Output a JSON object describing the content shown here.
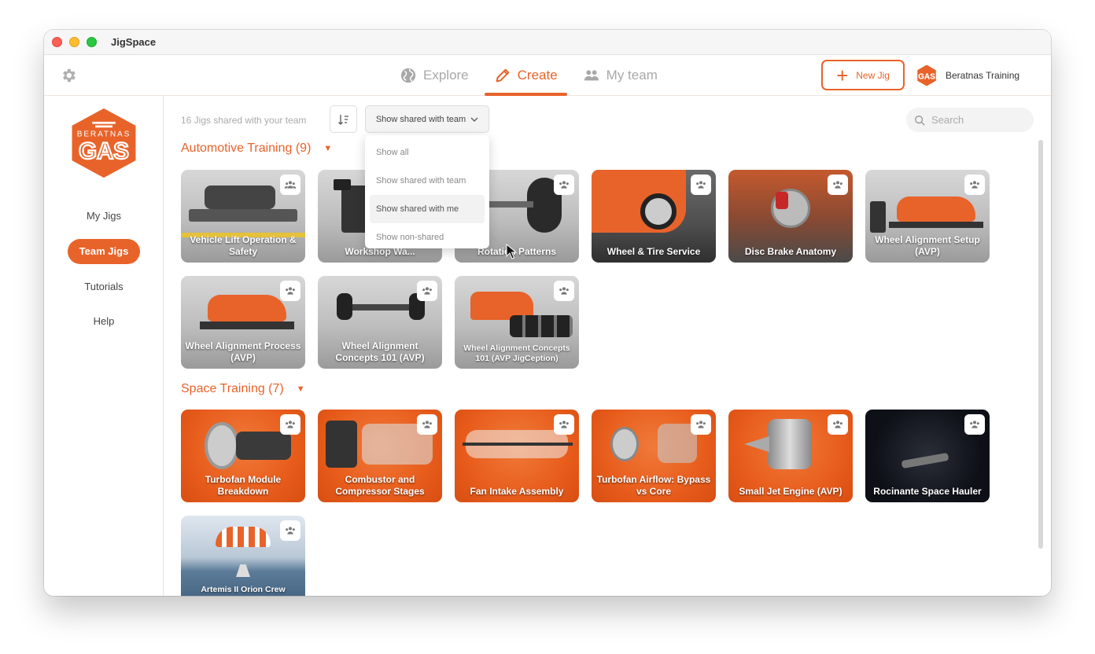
{
  "window": {
    "title": "JigSpace"
  },
  "nav": {
    "items": [
      {
        "label": "Explore",
        "active": false
      },
      {
        "label": "Create",
        "active": true
      },
      {
        "label": "My team",
        "active": false
      }
    ],
    "new_jig_label": "New Jig",
    "account_name": "Beratnas Training"
  },
  "sidebar": {
    "logo_top_text": "BERATNAS",
    "logo_main_text": "GAS",
    "items": [
      {
        "label": "My Jigs",
        "active": false
      },
      {
        "label": "Team Jigs",
        "active": true
      },
      {
        "label": "Tutorials",
        "active": false
      },
      {
        "label": "Help",
        "active": false
      }
    ]
  },
  "toolbar": {
    "count_text": "16 Jigs shared with your team",
    "filter_selected": "Show shared with team",
    "search_placeholder": "Search"
  },
  "dropdown": {
    "options": [
      "Show all",
      "Show shared with team",
      "Show shared with me",
      "Show non-shared"
    ],
    "hovered": "Show shared with me"
  },
  "sections": [
    {
      "title": "Automotive Training (9)",
      "cards": [
        {
          "label": "Vehicle Lift Operation & Safety"
        },
        {
          "label": "Workshop Wa..."
        },
        {
          "label": "Rotation Patterns"
        },
        {
          "label": "Wheel & Tire Service"
        },
        {
          "label": "Disc Brake Anatomy"
        },
        {
          "label": "Wheel Alignment Setup (AVP)"
        },
        {
          "label": "Wheel Alignment Process (AVP)"
        },
        {
          "label": "Wheel Alignment Concepts 101 (AVP)"
        },
        {
          "label": "Wheel Alignment Concepts 101 (AVP JigCeption)"
        }
      ]
    },
    {
      "title": "Space Training (7)",
      "cards": [
        {
          "label": "Turbofan Module Breakdown"
        },
        {
          "label": "Combustor and Compressor Stages"
        },
        {
          "label": "Fan Intake Assembly"
        },
        {
          "label": "Turbofan Airflow: Bypass vs Core"
        },
        {
          "label": "Small Jet Engine (AVP)"
        },
        {
          "label": "Rocinante Space Hauler"
        },
        {
          "label": "Artemis II Orion Crew"
        }
      ]
    }
  ],
  "colors": {
    "accent": "#e8632a",
    "text_muted": "#aaaaaa"
  },
  "icons": {
    "share": "team-share-icon",
    "settings": "gear-icon"
  }
}
